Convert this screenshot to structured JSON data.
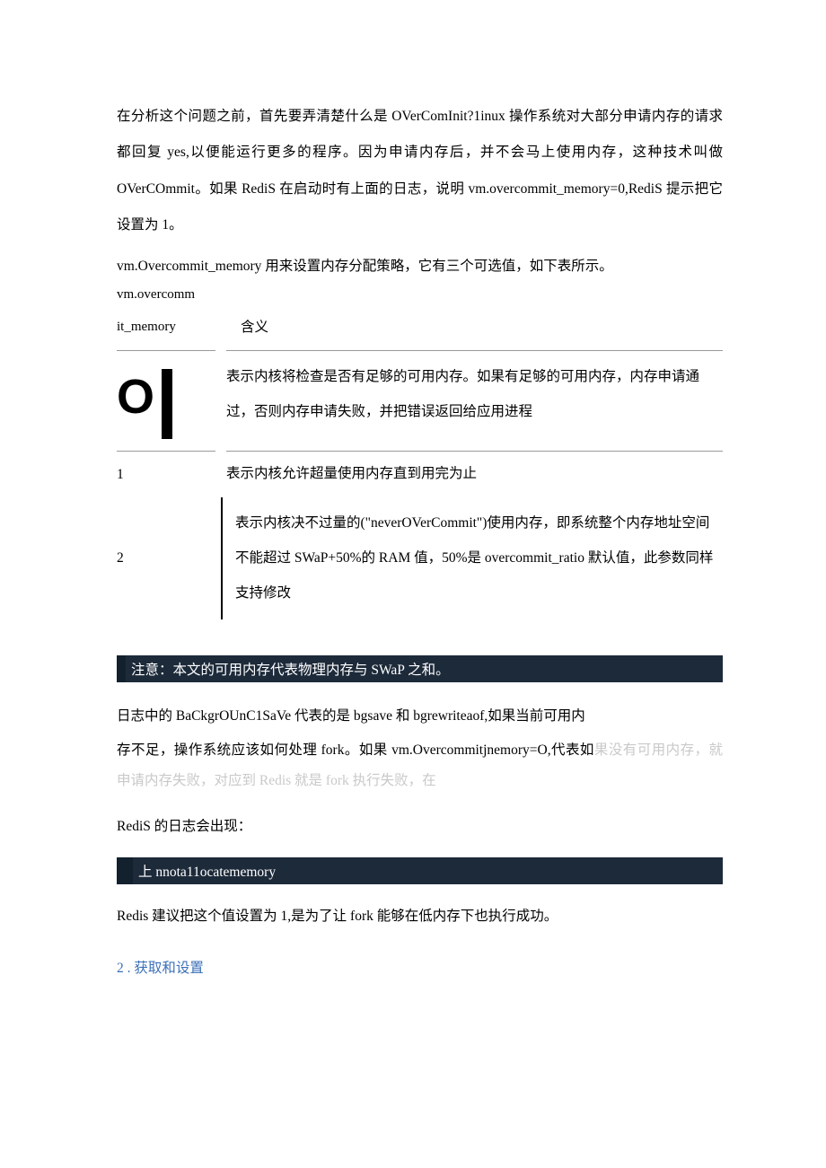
{
  "para1": "在分析这个问题之前，首先要弄清楚什么是 OVerComInit?1inux 操作系统对大部分申请内存的请求都回复 yes,以便能运行更多的程序。因为申请内存后，并不会马上使用内存，这种技术叫做 OVerCOmmit。如果 RediS 在启动时有上面的日志，说明 vm.overcommit_memory=0,RediS 提示把它设置为 1。",
  "para2": "vm.Overcommit_memory 用来设置内存分配策略，它有三个可选值，如下表所示。",
  "table": {
    "header_left_line1": "vm.overcomm",
    "header_left_line2": "it_memory",
    "header_right": "含义",
    "rows": [
      {
        "value": "O",
        "desc": "表示内核将检查是否有足够的可用内存。如果有足够的可用内存，内存申请通过，否则内存申请失败，并把错误返回给应用进程"
      },
      {
        "value": "1",
        "desc": "表示内核允许超量使用内存直到用完为止"
      },
      {
        "value": "2",
        "desc": "表示内核决不过量的(\"neverOVerCommit\")使用内存，即系统整个内存地址空间不能超过 SWaP+50%的 RAM 值，50%是 overcommit_ratio 默认值，此参数同样支持修改"
      }
    ]
  },
  "note_bar": "注意：本文的可用内存代表物理内存与 SWaP 之和。",
  "para3": "日志中的 BaCkgrOUnC1SaVe 代表的是 bgsave 和 bgrewriteaof,如果当前可用内",
  "para4_black": "存不足，操作系统应该如何处理 fork。如果 vm.Overcommitjnemory=O,代表如",
  "para4_gray": "果没有可用内存，就申请内存失败，对应到 Redis 就是 fork 执行失败，在",
  "para5": "RediS 的日志会出现：",
  "code_bar": "上 nnota11ocatememory",
  "para6": "Redis 建议把这个值设置为 1,是为了让 fork 能够在低内存下也执行成功。",
  "section2": "2  . 获取和设置"
}
